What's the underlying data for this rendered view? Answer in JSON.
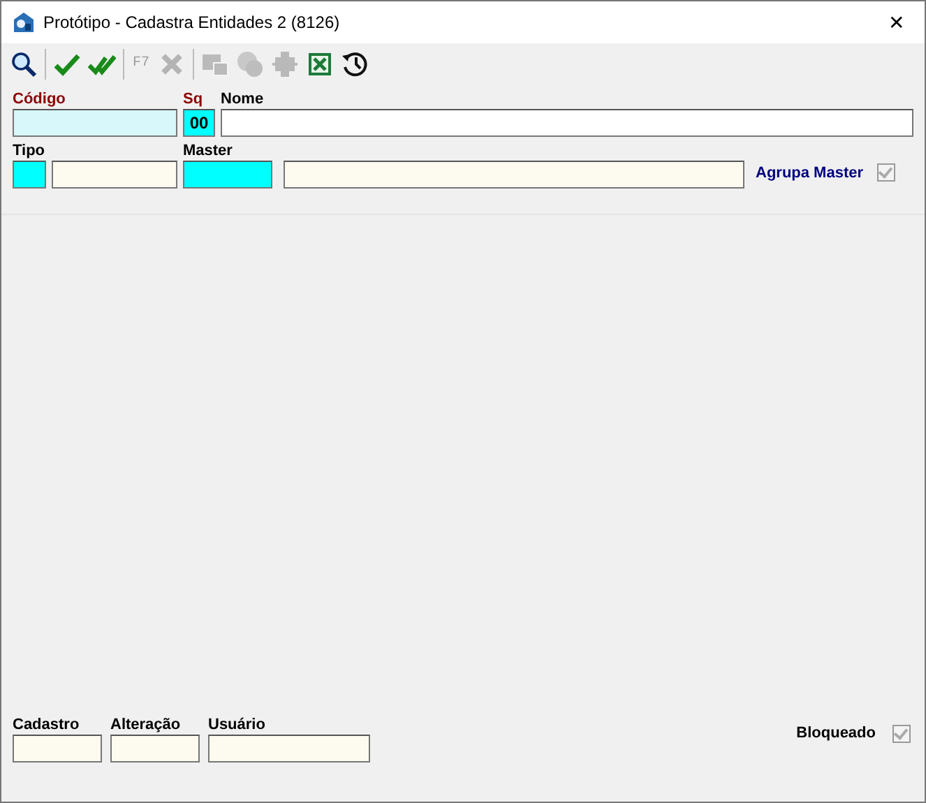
{
  "window": {
    "title": "Protótipo - Cadastra Entidades 2 (8126)",
    "close": "✕"
  },
  "toolbar": [
    {
      "kind": "search",
      "disabled": false
    },
    {
      "kind": "separator"
    },
    {
      "kind": "check",
      "disabled": false
    },
    {
      "kind": "double-check",
      "disabled": false
    },
    {
      "kind": "separator"
    },
    {
      "kind": "text",
      "label": "F7",
      "disabled": true
    },
    {
      "kind": "delete",
      "disabled": true
    },
    {
      "kind": "separator"
    },
    {
      "kind": "windows",
      "disabled": true
    },
    {
      "kind": "ball",
      "disabled": true
    },
    {
      "kind": "gear",
      "disabled": true
    },
    {
      "kind": "excel",
      "disabled": false
    },
    {
      "kind": "history",
      "disabled": false
    }
  ],
  "form": {
    "codigo": {
      "label": "Código",
      "required": true
    },
    "sq": {
      "label": "Sq",
      "value": "00",
      "required": true
    },
    "nome": {
      "label": "Nome",
      "required": false
    },
    "tipo": {
      "label": "Tipo"
    },
    "master": {
      "label": "Master"
    },
    "agrupa_master": {
      "label": "Agrupa Master",
      "checked": true,
      "disabled": true
    }
  },
  "footer": {
    "fields": [
      {
        "label": "Cadastro"
      },
      {
        "label": "Alteração"
      },
      {
        "label": "Usuário"
      }
    ],
    "bloqueado": {
      "label": "Bloqueado",
      "checked": true,
      "disabled": true
    }
  }
}
